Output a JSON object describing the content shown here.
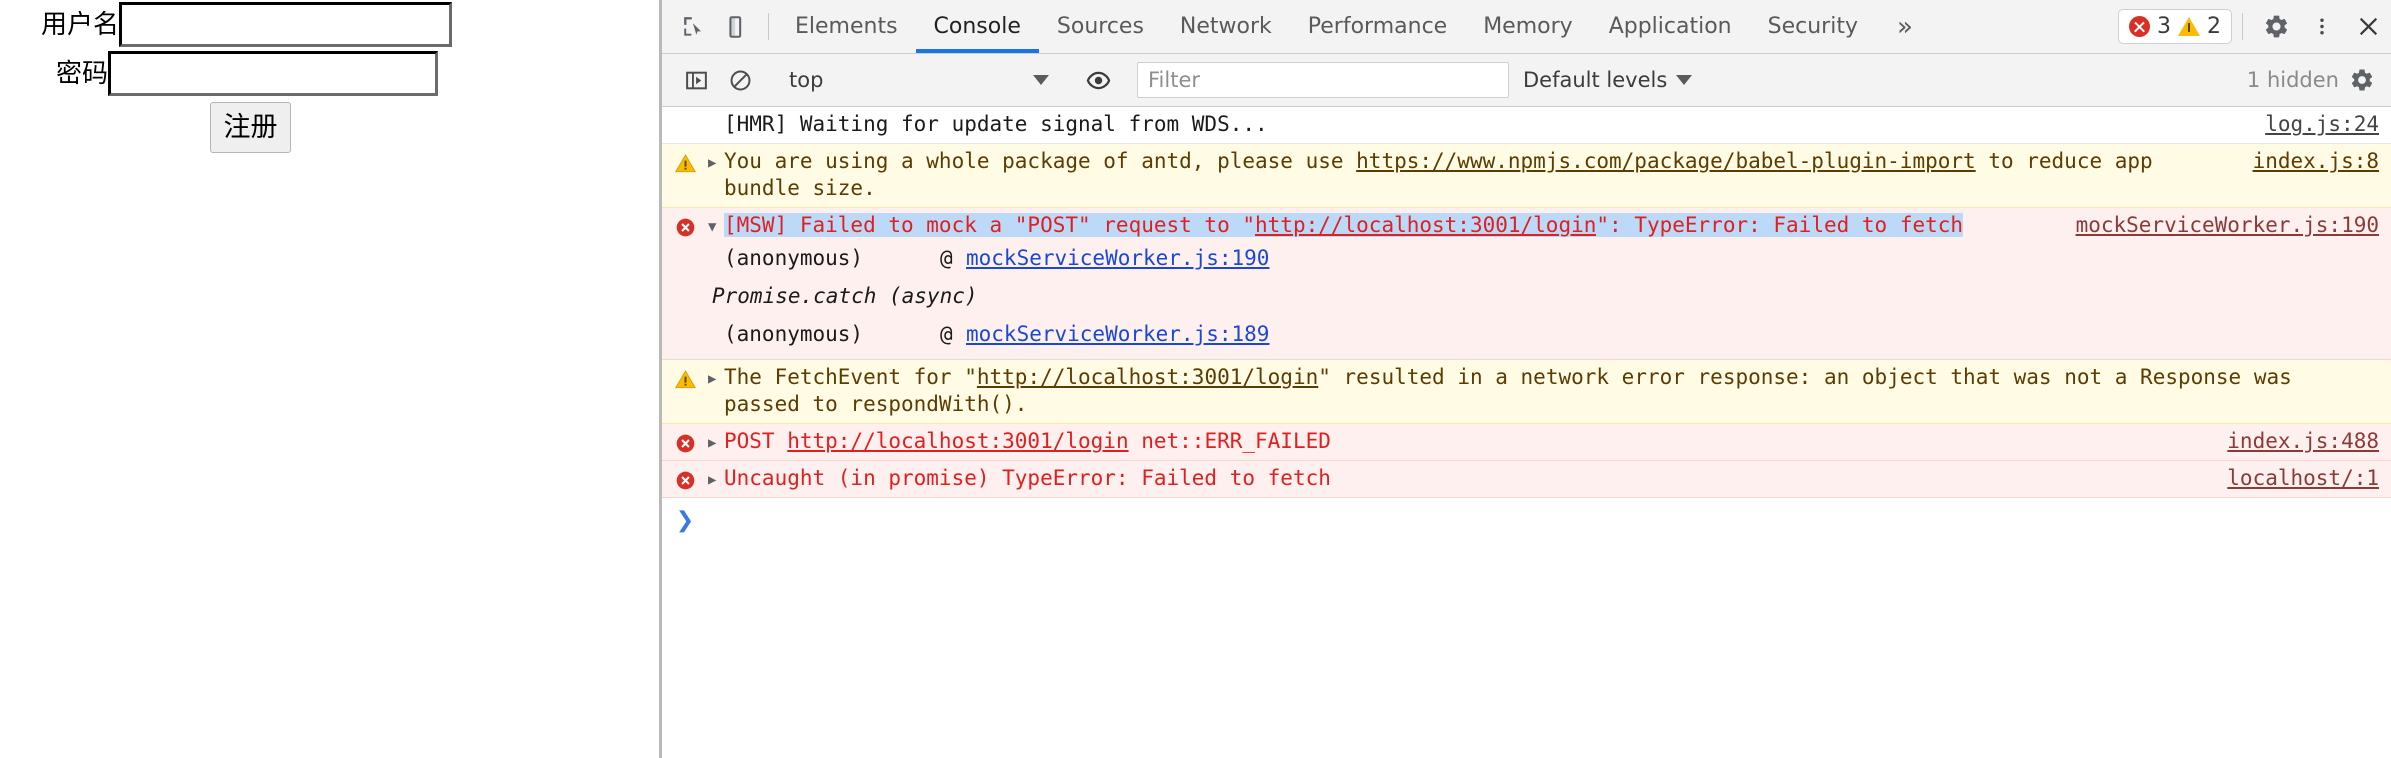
{
  "page": {
    "form": {
      "username_label": "用户名",
      "username_value": "",
      "password_label": "密码",
      "password_value": "",
      "submit_label": "注册"
    }
  },
  "devtools": {
    "tabs": [
      {
        "label": "Elements",
        "active": false
      },
      {
        "label": "Console",
        "active": true
      },
      {
        "label": "Sources",
        "active": false
      },
      {
        "label": "Network",
        "active": false
      },
      {
        "label": "Performance",
        "active": false
      },
      {
        "label": "Memory",
        "active": false
      },
      {
        "label": "Application",
        "active": false
      },
      {
        "label": "Security",
        "active": false
      }
    ],
    "more_tabs_glyph": "»",
    "issues": {
      "error_count": "3",
      "warning_count": "2"
    },
    "toolbar_icons": {
      "inspect": "inspect-element-icon",
      "device": "device-toolbar-icon",
      "settings": "gear-icon",
      "kebab": "more-options-icon",
      "close": "close-icon"
    },
    "console_toolbar": {
      "sidebar_toggle": "console-sidebar-icon",
      "clear": "clear-console-icon",
      "context_value": "top",
      "eye": "live-expression-icon",
      "filter_placeholder": "Filter",
      "filter_value": "",
      "levels_label": "Default levels",
      "hidden_label": "1 hidden",
      "settings": "console-settings-gear-icon"
    },
    "messages": [
      {
        "level": "log",
        "text": "[HMR] Waiting for update signal from WDS...",
        "source": "log.js:24"
      },
      {
        "level": "warn",
        "prefix": "You are using a whole package of antd, please use ",
        "link": "https://www.npmjs.com/package/babel-plugin-import",
        "suffix": " to reduce app bundle size.",
        "source": "index.js:8"
      },
      {
        "level": "error",
        "prefix": "[MSW] Failed to mock a \"POST\" request to \"",
        "link": "http://localhost:3001/login",
        "suffix": "\": TypeError: Failed to fetch",
        "source": "mockServiceWorker.js:190",
        "stack": [
          {
            "fn": "(anonymous)",
            "at": "@",
            "loc": "mockServiceWorker.js:190"
          },
          {
            "async": "Promise.catch (async)"
          },
          {
            "fn": "(anonymous)",
            "at": "@",
            "loc": "mockServiceWorker.js:189"
          }
        ]
      },
      {
        "level": "warn",
        "prefix": "The FetchEvent for \"",
        "link": "http://localhost:3001/login",
        "suffix": "\" resulted in a network error response: an object that was not a Response was passed to respondWith().",
        "source": ""
      },
      {
        "level": "error",
        "prefix": "POST ",
        "link": "http://localhost:3001/login",
        "suffix": " net::ERR_FAILED",
        "source": "index.js:488"
      },
      {
        "level": "error",
        "prefix": "Uncaught (in promise) TypeError: Failed to fetch",
        "link": "",
        "suffix": "",
        "source": "localhost/:1"
      }
    ],
    "prompt_glyph": "❯"
  },
  "colors": {
    "accent": "#1a73e8",
    "error": "#d93025",
    "warning": "#fabb05",
    "error_bg": "#fdf0ef",
    "warning_bg": "#fffbe5",
    "selection": "#bcd9f7",
    "link": "#1a47d8"
  }
}
